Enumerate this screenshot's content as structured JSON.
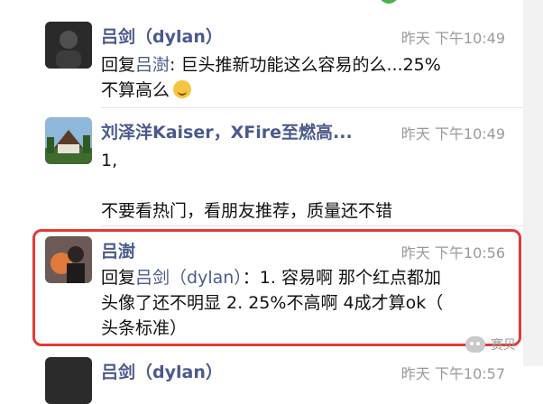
{
  "comments": [
    {
      "name": "吕剑（dylan）",
      "time": "昨天 下午10:49",
      "reply_prefix": "回复",
      "reply_to": "吕澍",
      "text": ": 巨头推新功能这么容易的么...25%",
      "text_line2": "不算高么",
      "emoji_icon": "laughing-tears-emoji"
    },
    {
      "name": "刘泽洋Kaiser，XFire至燃高...",
      "time": "昨天 下午10:49",
      "text": "1,",
      "text_line3": "不要看热门，看朋友推荐，质量还不错"
    },
    {
      "name": "吕澍",
      "time": "昨天 下午10:56",
      "reply_prefix": "回复",
      "reply_to": "吕剑（dylan）",
      "text": "：1. 容易啊 那个红点都加",
      "text_line2": "头像了还不明显 2. 25%不高啊 4成才算ok（",
      "text_line3": "头条标准）"
    },
    {
      "name": "吕剑（dylan）",
      "time": "昨天 下午10:57"
    }
  ],
  "watermark": {
    "label": "赛贝",
    "icon": "wechat-icon"
  },
  "colors": {
    "name": "#4a5a8c",
    "highlight": "#e53935",
    "time": "#9a9a9a"
  }
}
